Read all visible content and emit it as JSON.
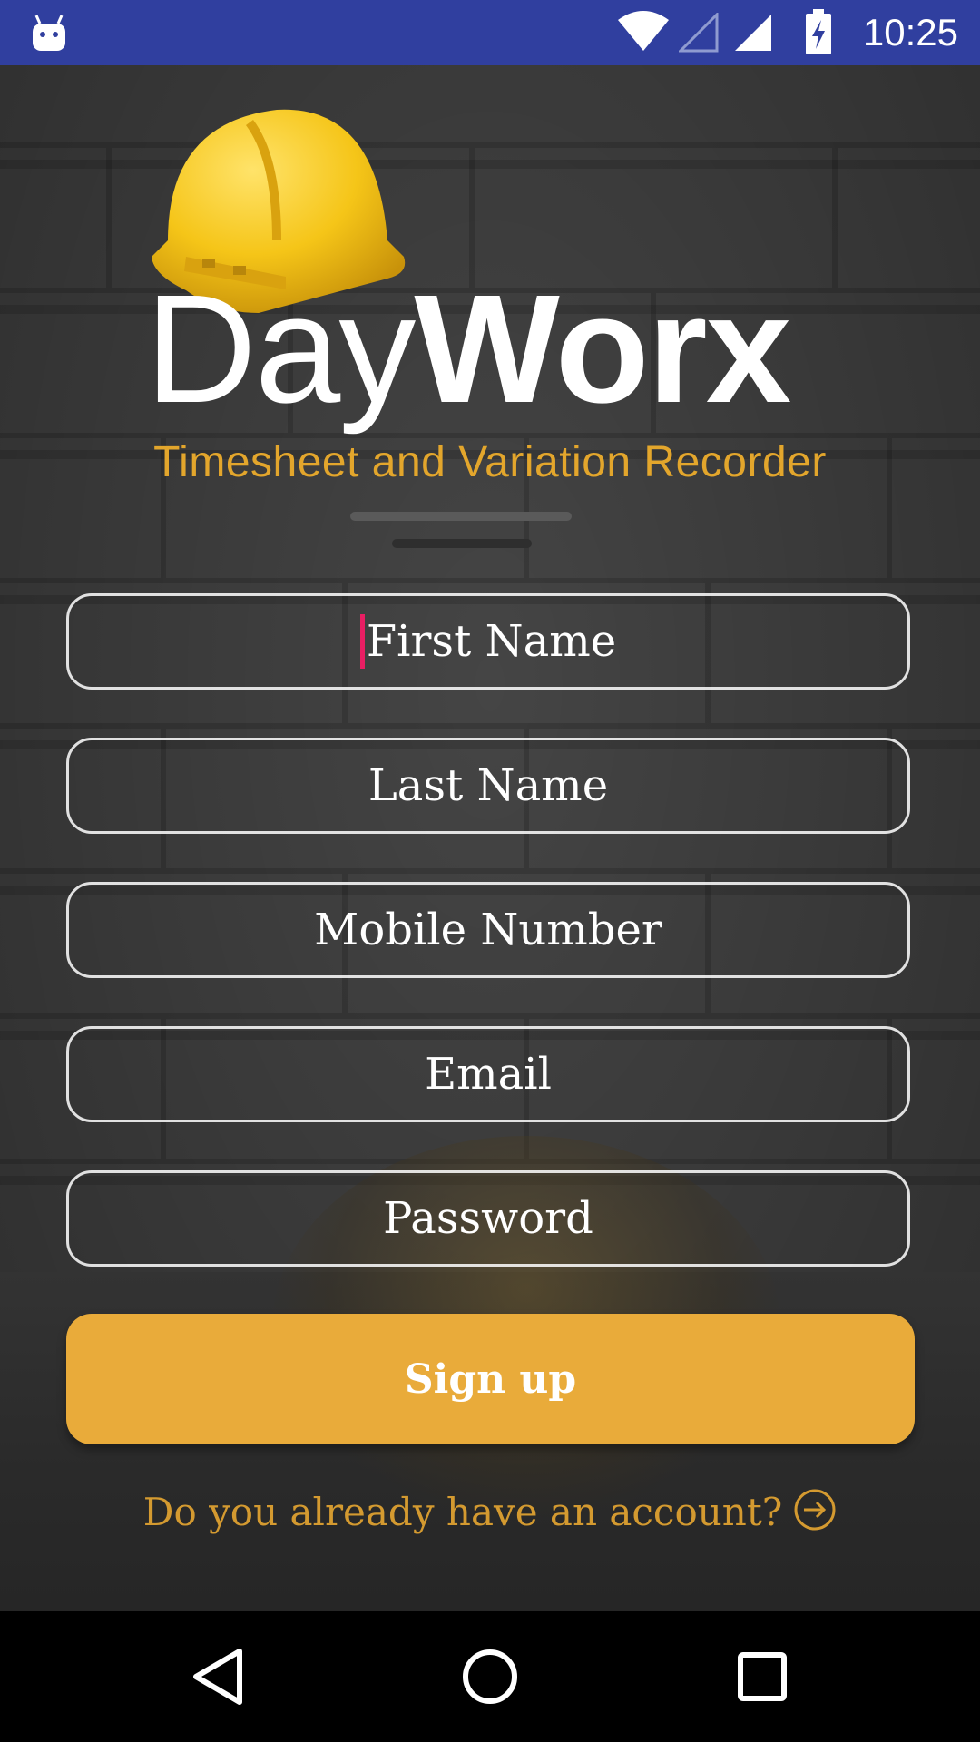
{
  "status_bar": {
    "time": "10:25",
    "icons": [
      "android-icon",
      "wifi-icon",
      "signal-empty-icon",
      "signal-icon",
      "battery-charging-icon"
    ],
    "background": "#303F9F"
  },
  "logo": {
    "word_light": "Day",
    "word_bold": "Worx",
    "tagline": "Timesheet and Variation Recorder",
    "helmet_color": "#F5C518"
  },
  "form": {
    "first_name": {
      "placeholder": "First Name",
      "value": ""
    },
    "last_name": {
      "placeholder": "Last Name",
      "value": ""
    },
    "mobile_number": {
      "placeholder": "Mobile Number",
      "value": ""
    },
    "email": {
      "placeholder": "Email",
      "value": ""
    },
    "password": {
      "placeholder": "Password",
      "value": ""
    }
  },
  "signup_button": {
    "label": "Sign up",
    "color": "#E9AB3A"
  },
  "login_link": {
    "label": "Do you already have an account?",
    "icon": "arrow-circle-icon",
    "color": "#D49A30"
  },
  "nav_bar": {
    "icons": [
      "back-icon",
      "home-icon",
      "recents-icon"
    ]
  },
  "colors": {
    "accent": "#E3A62C",
    "cursor": "#E91E63"
  }
}
